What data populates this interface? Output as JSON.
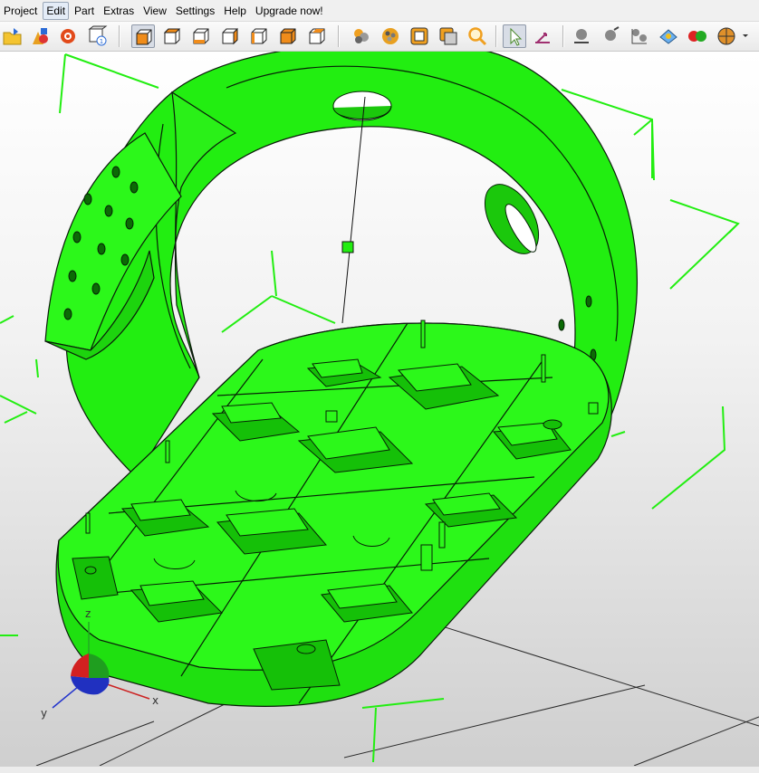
{
  "menu": {
    "project": "Project",
    "edit": "Edit",
    "part": "Part",
    "extras": "Extras",
    "view": "View",
    "settings": "Settings",
    "help": "Help",
    "upgrade": "Upgrade now!"
  },
  "toolbar": {
    "active_view": "iso-view",
    "active_tool": "select",
    "buttons": [
      "open-folder",
      "add-part",
      "duplicate-part",
      "part-info",
      "iso-view",
      "front-view",
      "back-view",
      "left-view",
      "right-view",
      "top-view",
      "bottom-view",
      "spheres-tool",
      "palette-tool",
      "frame-tool",
      "multi-frame-tool",
      "zoom-tool",
      "select",
      "measure-tool",
      "mesh-tool-1",
      "mesh-tool-2",
      "mesh-tool-3",
      "mesh-tool-4",
      "color-tool",
      "render-mode"
    ]
  },
  "viewport": {
    "model_color": "#22ee11",
    "axes": {
      "x": "x",
      "y": "y",
      "z": "z"
    },
    "axis_colors": {
      "x": "#cc2222",
      "y": "#2233cc",
      "z": "#22aa22"
    }
  }
}
